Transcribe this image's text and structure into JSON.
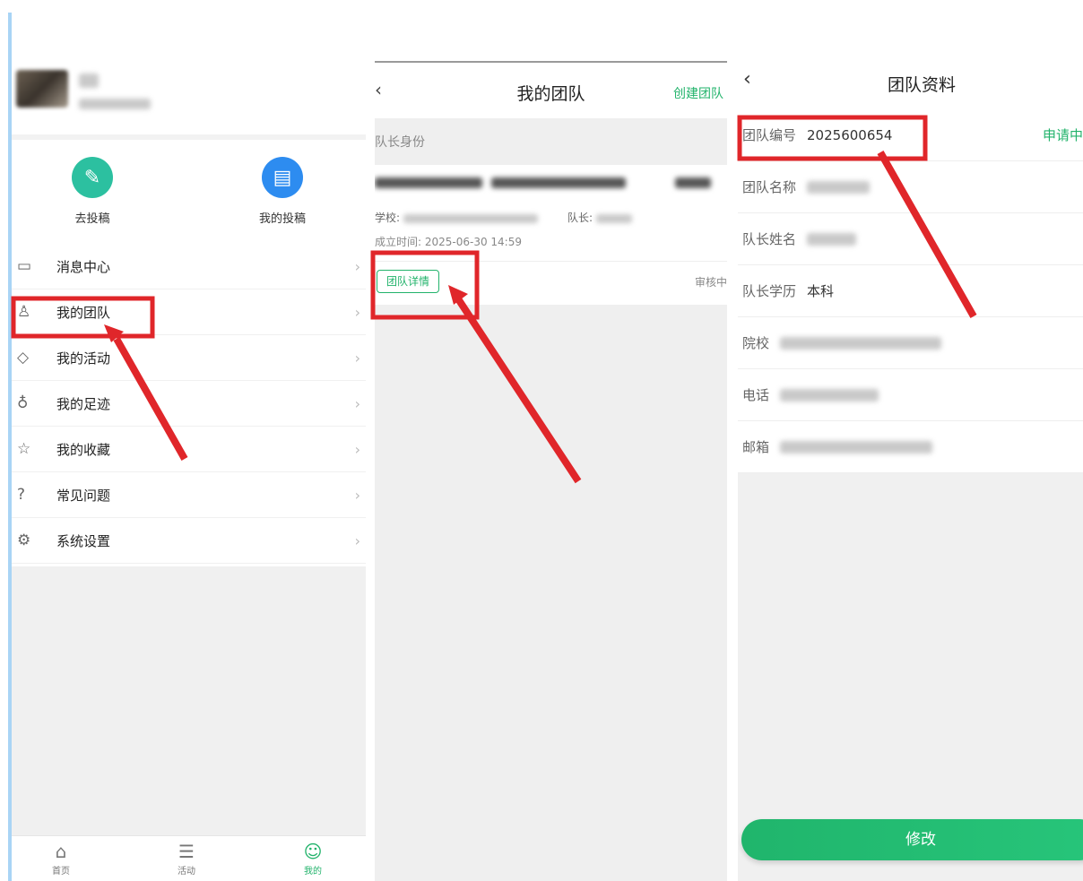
{
  "colors": {
    "accent": "#22b36b",
    "annotation": "#e0262a",
    "background": "#f0f0f0"
  },
  "profile_screen": {
    "quick_actions": [
      {
        "label": "去投稿",
        "icon": "pencil-icon",
        "color": "#2cc0a0"
      },
      {
        "label": "我的投稿",
        "icon": "clipboard-icon",
        "color": "#2d8cf0"
      }
    ],
    "menu": [
      {
        "label": "消息中心",
        "icon": "message-icon",
        "glyph": "▭"
      },
      {
        "label": "我的团队",
        "icon": "team-icon",
        "glyph": "♙"
      },
      {
        "label": "我的活动",
        "icon": "activity-tag-icon",
        "glyph": "◇"
      },
      {
        "label": "我的足迹",
        "icon": "footprint-icon",
        "glyph": "♁"
      },
      {
        "label": "我的收藏",
        "icon": "star-icon",
        "glyph": "☆"
      },
      {
        "label": "常见问题",
        "icon": "question-icon",
        "glyph": "?"
      },
      {
        "label": "系统设置",
        "icon": "gear-icon",
        "glyph": "⚙"
      }
    ],
    "chevron": "›",
    "tabs": [
      {
        "label": "首页",
        "icon": "home-icon",
        "glyph": "⌂"
      },
      {
        "label": "活动",
        "icon": "activity-icon",
        "glyph": "☰"
      },
      {
        "label": "我的",
        "icon": "profile-icon",
        "glyph": "☺",
        "active": true
      }
    ]
  },
  "team_list_screen": {
    "back_glyph": "‹",
    "title": "我的团队",
    "create_button": "创建团队",
    "section_label": "队长身份",
    "card": {
      "school_label": "学校:",
      "leader_label": "队长:",
      "established": "成立时间: 2025-06-30 14:59",
      "detail_button": "团队详情",
      "status": "审核中"
    }
  },
  "team_profile_screen": {
    "back_glyph": "‹",
    "title": "团队资料",
    "fields": [
      {
        "label": "团队编号",
        "value": "2025600654",
        "status": "申请中"
      },
      {
        "label": "团队名称",
        "value": ""
      },
      {
        "label": "队长姓名",
        "value": ""
      },
      {
        "label": "队长学历",
        "value": "本科"
      },
      {
        "label": "院校",
        "value": ""
      },
      {
        "label": "电话",
        "value": ""
      },
      {
        "label": "邮箱",
        "value": ""
      }
    ],
    "modify_button": "修改"
  }
}
